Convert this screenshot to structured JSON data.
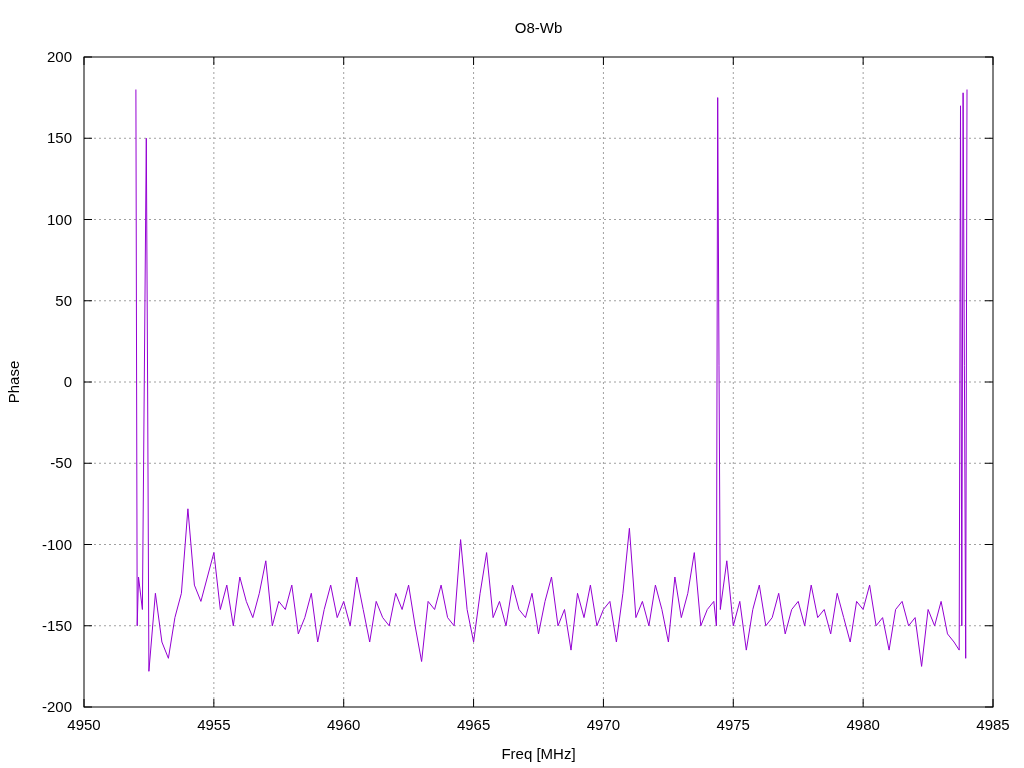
{
  "chart_data": {
    "type": "line",
    "grid": true,
    "title": "O8-Wb",
    "xlabel": "Freq [MHz]",
    "ylabel": "Phase",
    "xlim": [
      4950,
      4985
    ],
    "ylim": [
      -200,
      200
    ],
    "xticks": [
      4950,
      4955,
      4960,
      4965,
      4970,
      4975,
      4980,
      4985
    ],
    "yticks": [
      -200,
      -150,
      -100,
      -50,
      0,
      50,
      100,
      150,
      200
    ],
    "x": [
      4952,
      4952.05,
      4952.1,
      4952.25,
      4952.4,
      4952.45,
      4952.5,
      4952.75,
      4953,
      4953.25,
      4953.5,
      4953.75,
      4954,
      4954.25,
      4954.5,
      4954.75,
      4955,
      4955.25,
      4955.5,
      4955.75,
      4956,
      4956.25,
      4956.5,
      4956.75,
      4957,
      4957.25,
      4957.5,
      4957.75,
      4958,
      4958.25,
      4958.5,
      4958.75,
      4959,
      4959.25,
      4959.5,
      4959.75,
      4960,
      4960.25,
      4960.5,
      4960.75,
      4961,
      4961.25,
      4961.5,
      4961.75,
      4962,
      4962.25,
      4962.5,
      4962.75,
      4963,
      4963.25,
      4963.5,
      4963.75,
      4964,
      4964.25,
      4964.5,
      4964.75,
      4965,
      4965.25,
      4965.5,
      4965.75,
      4966,
      4966.25,
      4966.5,
      4966.75,
      4967,
      4967.25,
      4967.5,
      4967.75,
      4968,
      4968.25,
      4968.5,
      4968.75,
      4969,
      4969.25,
      4969.5,
      4969.75,
      4970,
      4970.25,
      4970.5,
      4970.75,
      4971,
      4971.25,
      4971.5,
      4971.75,
      4972,
      4972.25,
      4972.5,
      4972.75,
      4973,
      4973.25,
      4973.5,
      4973.75,
      4974,
      4974.25,
      4974.35,
      4974.4,
      4974.45,
      4974.5,
      4974.75,
      4975,
      4975.25,
      4975.5,
      4975.75,
      4976,
      4976.25,
      4976.5,
      4976.75,
      4977,
      4977.25,
      4977.5,
      4977.75,
      4978,
      4978.25,
      4978.5,
      4978.75,
      4979,
      4979.25,
      4979.5,
      4979.75,
      4980,
      4980.25,
      4980.5,
      4980.75,
      4981,
      4981.25,
      4981.5,
      4981.75,
      4982,
      4982.25,
      4982.5,
      4982.75,
      4983,
      4983.25,
      4983.5,
      4983.7,
      4983.75,
      4983.8,
      4983.85,
      4983.9,
      4983.95,
      4984
    ],
    "series": [
      {
        "color": "#9400d3",
        "values": [
          180,
          -150,
          -120,
          -140,
          150,
          0,
          -178,
          -130,
          -160,
          -170,
          -145,
          -130,
          -78,
          -125,
          -135,
          -120,
          -105,
          -140,
          -125,
          -150,
          -120,
          -135,
          -145,
          -130,
          -110,
          -150,
          -135,
          -140,
          -125,
          -155,
          -145,
          -130,
          -160,
          -140,
          -125,
          -145,
          -135,
          -150,
          -120,
          -140,
          -160,
          -135,
          -145,
          -150,
          -130,
          -140,
          -125,
          -150,
          -172,
          -135,
          -140,
          -125,
          -145,
          -150,
          -97,
          -140,
          -160,
          -130,
          -105,
          -145,
          -135,
          -150,
          -125,
          -140,
          -145,
          -130,
          -155,
          -135,
          -120,
          -150,
          -140,
          -165,
          -130,
          -145,
          -125,
          -150,
          -140,
          -135,
          -160,
          -130,
          -90,
          -145,
          -135,
          -150,
          -125,
          -140,
          -160,
          -120,
          -145,
          -130,
          -105,
          -150,
          -140,
          -135,
          -150,
          175,
          10,
          -140,
          -110,
          -150,
          -135,
          -165,
          -140,
          -125,
          -150,
          -145,
          -130,
          -155,
          -140,
          -135,
          -150,
          -125,
          -145,
          -140,
          -155,
          -130,
          -145,
          -160,
          -135,
          -140,
          -125,
          -150,
          -145,
          -165,
          -140,
          -135,
          -150,
          -145,
          -175,
          -140,
          -150,
          -135,
          -155,
          -160,
          -165,
          170,
          -150,
          178,
          10,
          -170,
          180
        ]
      }
    ]
  }
}
